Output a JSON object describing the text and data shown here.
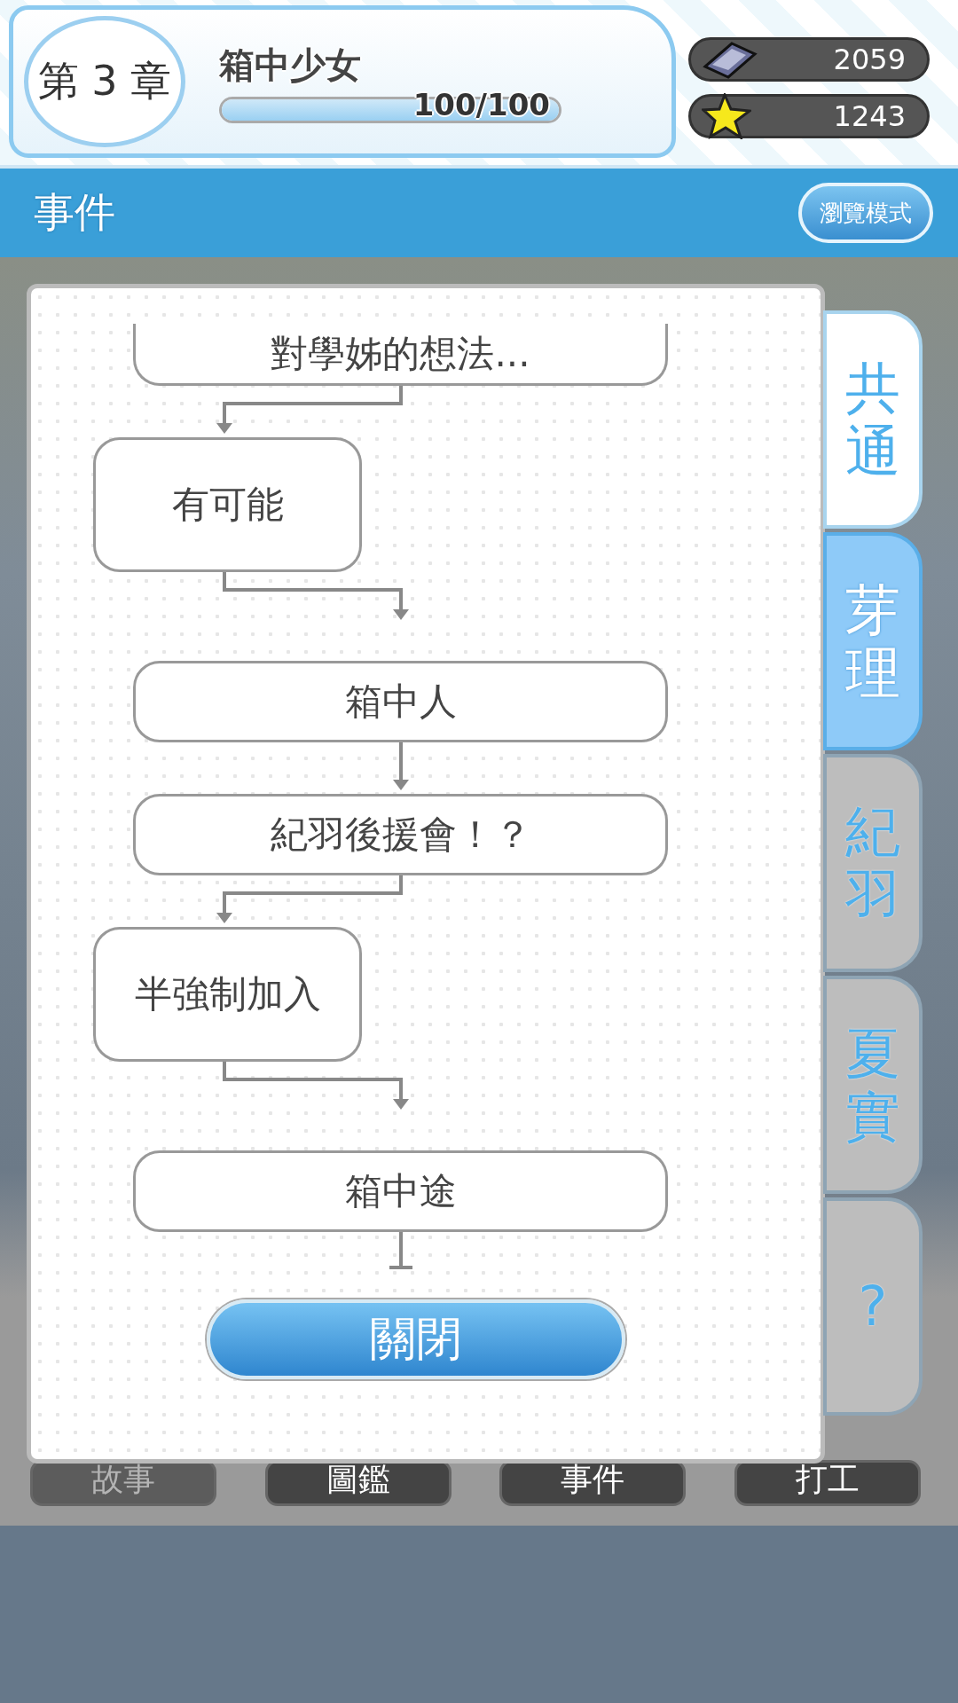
{
  "chapter": {
    "label": "第 3 章",
    "title": "箱中少女",
    "progress": {
      "level": 1,
      "reading": "100/100"
    }
  },
  "counters": [
    {
      "kind": "gem",
      "value": "2059"
    },
    {
      "kind": "star",
      "value": "1243"
    }
  ],
  "section": {
    "title": "事件",
    "browse_button": "瀏覽模式"
  },
  "flowchart": {
    "nodes": [
      {
        "kind": "wide",
        "text": "對學姊的想法..."
      },
      {
        "kind": "narrow",
        "text": "有可能"
      },
      {
        "kind": "wide",
        "text": "箱中人"
      },
      {
        "kind": "wide",
        "text": "紀羽後援會！？"
      },
      {
        "kind": "narrow",
        "text": "半強制加入"
      },
      {
        "kind": "wide",
        "text": "箱中途"
      }
    ],
    "close_button": "關閉"
  },
  "side_tabs": [
    {
      "label": "共通",
      "selected": false,
      "enabled": true
    },
    {
      "label": "芽理",
      "selected": true,
      "enabled": true
    },
    {
      "label": "紀羽",
      "selected": false,
      "enabled": false
    },
    {
      "label": "夏實",
      "selected": false,
      "enabled": false
    },
    {
      "label": "?",
      "selected": false,
      "enabled": false
    }
  ],
  "bottom_nav": [
    {
      "label": "故事",
      "disabled": true
    },
    {
      "label": "圖鑑",
      "disabled": false
    },
    {
      "label": "事件",
      "disabled": false
    },
    {
      "label": "打工",
      "disabled": false
    }
  ]
}
